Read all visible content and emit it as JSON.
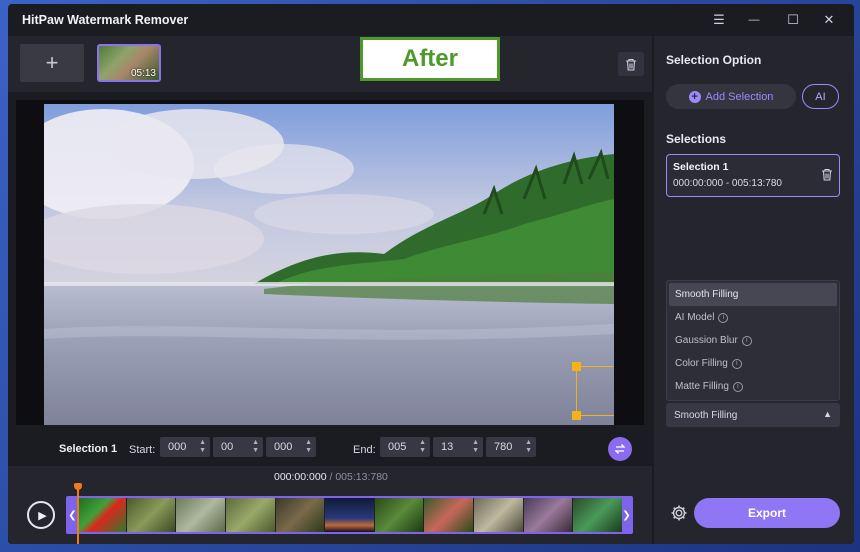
{
  "app": {
    "title": "HitPaw Watermark Remover"
  },
  "window_controls": {
    "menu": "☰",
    "minimize": "—",
    "maximize": "☐",
    "close": "✕"
  },
  "topbar": {
    "add_label": "+",
    "thumbnail_time": "05:13",
    "after_label": "After"
  },
  "controls": {
    "selection_label": "Selection 1",
    "start_label": "Start:",
    "start": [
      "000",
      "00",
      "000"
    ],
    "end_label": "End:",
    "end": [
      "005",
      "13",
      "780"
    ]
  },
  "timeline": {
    "current": "000:00:000",
    "separator": " / ",
    "total": "005:13:780"
  },
  "right_panel": {
    "selection_option_title": "Selection Option",
    "add_selection_label": "Add Selection",
    "ai_label": "AI",
    "selections_title": "Selections",
    "selections": [
      {
        "title": "Selection 1",
        "range": "000:00:000 - 005:13:780"
      }
    ],
    "fill_options": [
      {
        "label": "Smooth Filling",
        "info": false,
        "selected": true
      },
      {
        "label": "AI Model",
        "info": true,
        "selected": false
      },
      {
        "label": "Gaussion Blur",
        "info": true,
        "selected": false
      },
      {
        "label": "Color Filling",
        "info": true,
        "selected": false
      },
      {
        "label": "Matte Filling",
        "info": true,
        "selected": false
      }
    ],
    "fill_selected": "Smooth Filling",
    "export_label": "Export"
  },
  "colors": {
    "accent": "#8e76f4",
    "after_green": "#4d9a2b",
    "selection_box": "#f5b316",
    "playhead": "#f07b1f"
  }
}
